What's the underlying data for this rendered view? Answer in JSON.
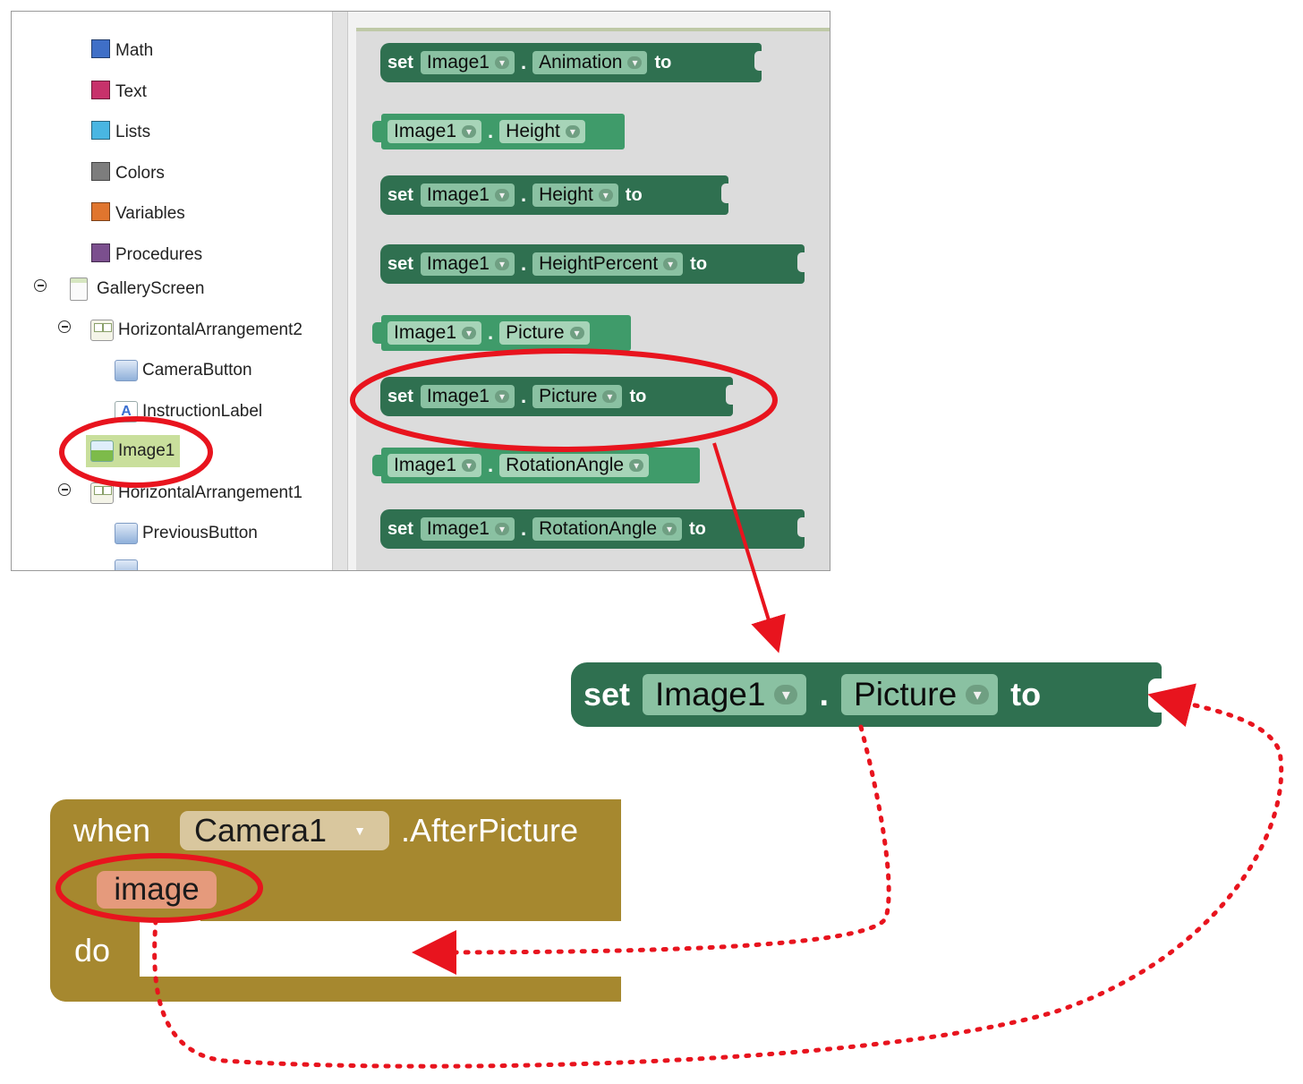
{
  "tree": {
    "builtins": [
      {
        "label": "Math",
        "color": "#3f6fc7"
      },
      {
        "label": "Text",
        "color": "#c7326b"
      },
      {
        "label": "Lists",
        "color": "#49b6e2"
      },
      {
        "label": "Colors",
        "color": "#7d7d7d"
      },
      {
        "label": "Variables",
        "color": "#e0752e"
      },
      {
        "label": "Procedures",
        "color": "#7b4f8e"
      }
    ],
    "components": [
      {
        "label": "GalleryScreen",
        "icon": "screen-icon"
      },
      {
        "label": "HorizontalArrangement2",
        "icon": "horizontal-arrangement-icon"
      },
      {
        "label": "CameraButton",
        "icon": "button-icon"
      },
      {
        "label": "InstructionLabel",
        "icon": "label-icon"
      },
      {
        "label": "Image1",
        "icon": "image-icon"
      },
      {
        "label": "HorizontalArrangement1",
        "icon": "horizontal-arrangement-icon"
      },
      {
        "label": "PreviousButton",
        "icon": "button-icon"
      }
    ]
  },
  "blocks": {
    "set_kw": "set",
    "to_kw": "to",
    "dot": ".",
    "component": "Image1",
    "properties": {
      "animation": "Animation",
      "height": "Height",
      "height_percent": "HeightPercent",
      "picture": "Picture",
      "rotation_angle": "RotationAngle"
    },
    "dropdown_glyph": "▾"
  },
  "event": {
    "when_kw": "when",
    "component": "Camera1",
    "event_name": ".AfterPicture",
    "param": "image",
    "do_kw": "do",
    "dropdown_glyph": "▼"
  },
  "colors": {
    "set_block": "#2f7050",
    "getter_block": "#3f9b6a",
    "event_block": "#a6882f",
    "annotation": "#e8141e"
  }
}
